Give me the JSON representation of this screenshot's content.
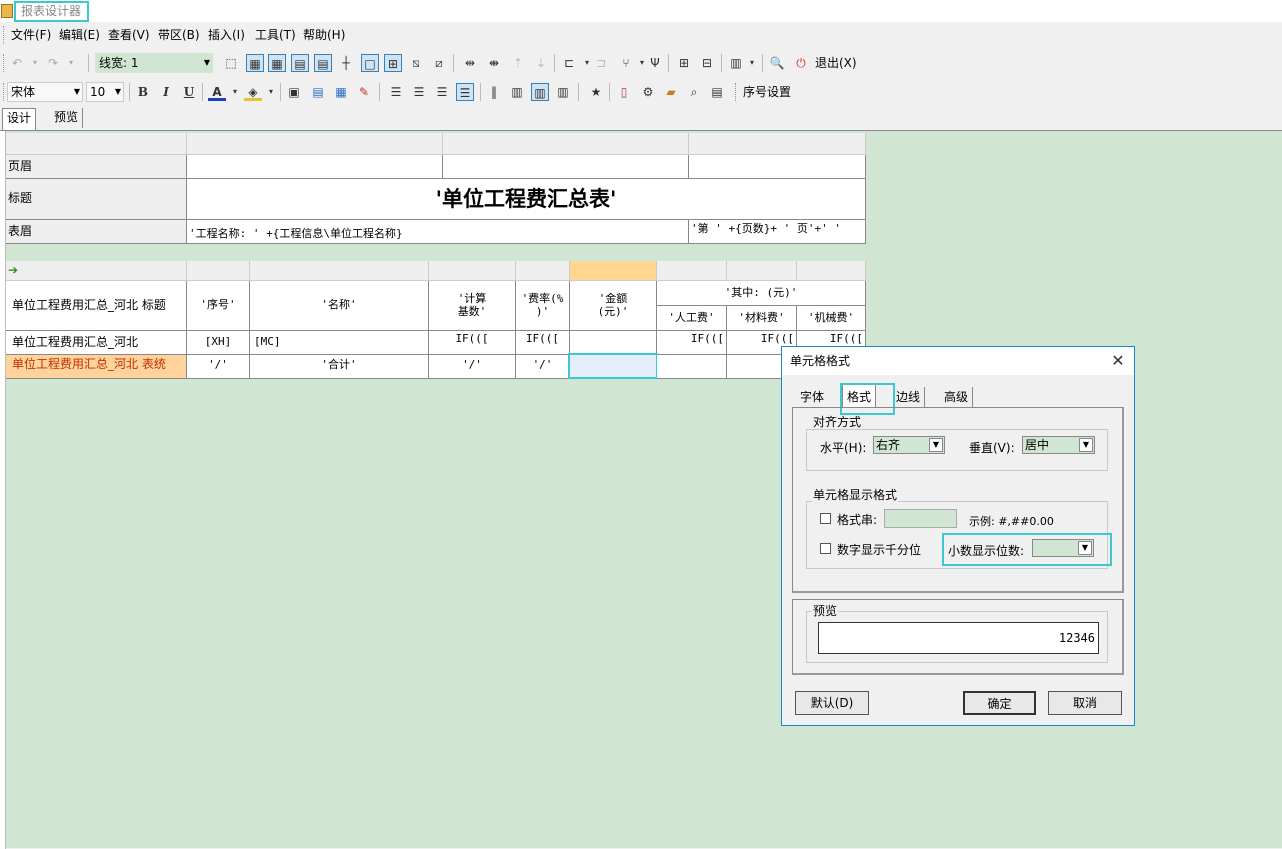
{
  "app": {
    "title": "报表设计器"
  },
  "menu": [
    "文件(F)",
    "编辑(E)",
    "查看(V)",
    "带区(B)",
    "插入(I)",
    "工具(T)",
    "帮助(H)"
  ],
  "toolbar1": {
    "line_width_label": "线宽: 1",
    "exit_label": "退出(X)"
  },
  "toolbar2": {
    "font": "宋体",
    "size": "10",
    "bold": "B",
    "italic": "I",
    "underline": "U",
    "seq_label": "序号设置"
  },
  "tabs": [
    "设计",
    "预览"
  ],
  "bands": {
    "page_header": "页眉",
    "title": "标题",
    "table_header": "表眉",
    "report_title": "'单位工程费汇总表'",
    "project_name_expr": "'工程名称: ' +{工程信息\\单位工程名称}",
    "page_expr": "'第 ' +{页数}+ ' 页'+' '",
    "arrow": "➔"
  },
  "grid": {
    "row_header_title": "单位工程费用汇总_河北 标题",
    "row_header_body": "单位工程费用汇总_河北",
    "row_header_total": "单位工程费用汇总_河北 表统",
    "col_seq": "'序号'",
    "col_name": "'名称'",
    "col_base": "'计算\n基数'",
    "col_rate": "'费率(%\n)'",
    "col_amount": "'金额\n(元)'",
    "col_among": "'其中: (元)'",
    "col_labor": "'人工费'",
    "col_material": "'材料费'",
    "col_machine": "'机械费'",
    "body_seq": "[XH]",
    "body_name": "[MC]",
    "body_base": "IF(([",
    "body_rate": "IF(([",
    "body_labor": "IF(([",
    "body_material": "IF(([",
    "body_machine": "IF(([",
    "total_seq": "'/'",
    "total_name": "'合计'",
    "total_base": "'/'",
    "total_rate": "'/'"
  },
  "dialog": {
    "title": "单元格格式",
    "close": "✕",
    "tabs": [
      "字体",
      "格式",
      "边线",
      "高级"
    ],
    "align_group": "对齐方式",
    "horizontal_label": "水平(H):",
    "horizontal_value": "右齐",
    "vertical_label": "垂直(V):",
    "vertical_value": "居中",
    "display_group": "单元格显示格式",
    "format_string_label": "格式串:",
    "example_label": "示例: #,##0.00",
    "thousands_label": "数字显示千分位",
    "decimals_label": "小数显示位数:",
    "decimals_value": "",
    "preview_group": "预览",
    "preview_value": "12346",
    "default_button": "默认(D)",
    "ok_button": "确定",
    "cancel_button": "取消"
  },
  "colors": {
    "accent_highlight": "#3cc8cf",
    "canvas_bg": "#d1e6d2",
    "selected_col": "#ffd590",
    "total_row": "#ffd39b",
    "dialog_border": "#1883d7"
  }
}
